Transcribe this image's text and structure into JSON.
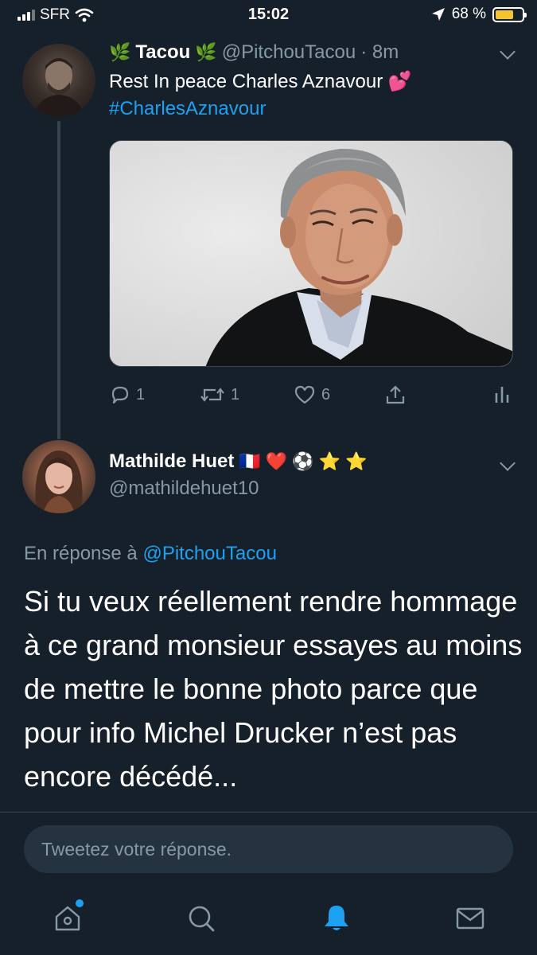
{
  "status_bar": {
    "carrier": "SFR",
    "time": "15:02",
    "battery": "68 %",
    "battery_level": 0.68,
    "battery_color": "#f4c430"
  },
  "tweet1": {
    "display_name": "Tacou",
    "name_emoji": "🌿",
    "handle": "@PitchouTacou",
    "time": "· 8m",
    "text": "Rest In peace Charles Aznavour",
    "text_emoji": "💕",
    "hashtag": "#CharlesAznavour",
    "reply_count": "1",
    "retweet_count": "1",
    "like_count": "6"
  },
  "tweet2": {
    "display_name": "Mathilde Huet",
    "name_emojis": "🇫🇷 ❤️ ⚽ ⭐ ⭐",
    "handle": "@mathildehuet10",
    "reply_prefix": "En réponse à",
    "reply_handle": "@PitchouTacou",
    "text": "Si tu veux réellement rendre hommage à ce grand monsieur essayes au moins de mettre le bonne photo parce que pour info Michel Drucker n’est pas encore décédé..."
  },
  "compose": {
    "placeholder": "Tweetez votre réponse."
  },
  "tabbar": {
    "items": [
      "home-icon",
      "search-icon",
      "notifications-icon",
      "messages-icon"
    ],
    "active": "notifications-icon"
  },
  "colors": {
    "background": "#15202b",
    "accent": "#1da1f2",
    "secondary_text": "#8899a6",
    "divider": "#38444d"
  }
}
